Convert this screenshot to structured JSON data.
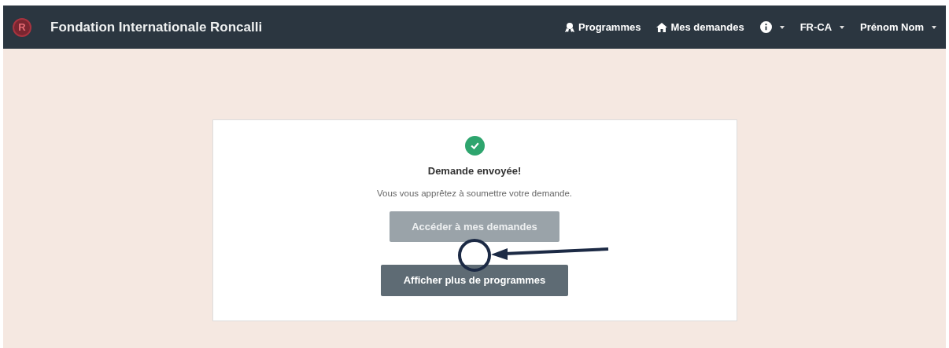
{
  "navbar": {
    "brand": "Fondation Internationale Roncalli",
    "logo_letter": "R",
    "links": [
      {
        "kind": "programs",
        "label": "Programmes"
      },
      {
        "kind": "requests",
        "label": "Mes demandes"
      },
      {
        "kind": "info"
      },
      {
        "kind": "menu",
        "label": "FR-CA"
      },
      {
        "kind": "menu",
        "label": "Prénom Nom"
      }
    ]
  },
  "card": {
    "title": "Demande envoyée!",
    "message": "Vous vous apprêtez à soumettre votre demande.",
    "buttons": [
      {
        "label": "Accéder à mes demandes",
        "disabled": true
      },
      {
        "label": "Afficher plus de programmes",
        "disabled": false
      }
    ]
  }
}
